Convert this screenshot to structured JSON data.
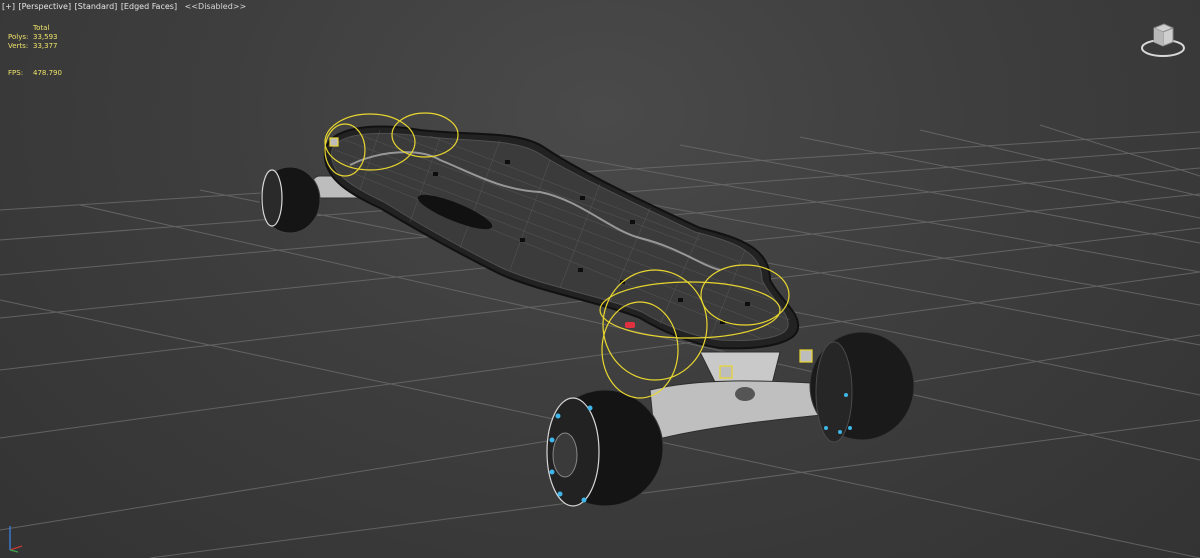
{
  "viewport_menu": {
    "plus": "[+]",
    "view": "[Perspective]",
    "shading": "[Standard]",
    "edges": "[Edged Faces]",
    "mode": "<<Disabled>>"
  },
  "stats": {
    "header": "Total",
    "polys_label": "Polys:",
    "polys_value": "33,593",
    "verts_label": "Verts:",
    "verts_value": "33,377",
    "fps_label": "FPS:",
    "fps_value": "478.790"
  },
  "colors": {
    "viewport_bg": "#3e3e3e",
    "grid": "#6c6c6c",
    "stats_text": "#f0e46a",
    "selection_gizmo": "#e8d630",
    "wheel_accent": "#3fb6e8",
    "marker_red": "#e23040"
  },
  "icons": {
    "viewcube": "viewcube-icon",
    "axis": "axis-tripod-icon"
  }
}
